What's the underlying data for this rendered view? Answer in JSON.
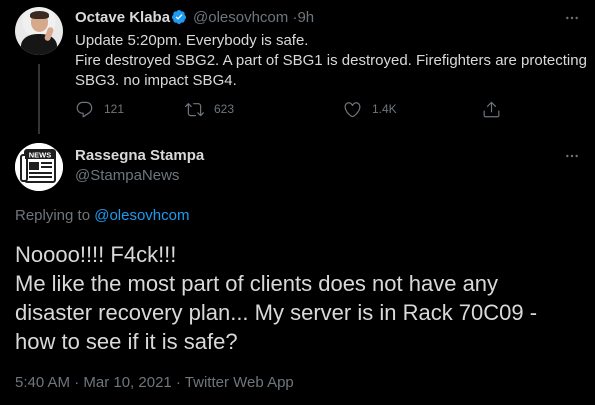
{
  "parent_tweet": {
    "display_name": "Octave Klaba",
    "handle": "@olesovhcom",
    "time_sep": "·",
    "age": "9h",
    "lines": [
      "Update 5:20pm. Everybody is safe.",
      "Fire destroyed SBG2. A part of SBG1 is destroyed. Firefighters are protecting",
      "SBG3. no impact SBG4."
    ],
    "stats": {
      "replies": "121",
      "retweets": "623",
      "likes": "1.4K"
    },
    "icons": [
      "verified-icon",
      "more-icon",
      "reply-icon",
      "retweet-icon",
      "like-icon",
      "share-icon"
    ]
  },
  "reply_tweet": {
    "display_name": "Rassegna Stampa",
    "handle": "@StampaNews",
    "avatar_text": "NEWS",
    "replying_prefix": "Replying to",
    "replying_handle": "@olesovhcom",
    "lines": [
      "Noooo!!!! F4ck!!!",
      "Me like the most part of clients does not have any",
      "disaster recovery plan... My server is in Rack 70C09 -",
      "how to see if it is safe?"
    ],
    "meta": "5:40 AM · Mar 10, 2021 · Twitter Web App",
    "icons": [
      "news-avatar-icon",
      "more-icon"
    ]
  },
  "colors": {
    "background": "#000000",
    "text": "#d9d9d9",
    "secondary": "#6e767d",
    "link": "#1d9bf0",
    "thread_line": "#333639",
    "verified": "#1d9bf0"
  }
}
